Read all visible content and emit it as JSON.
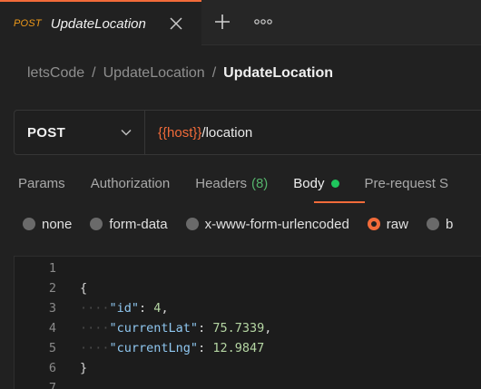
{
  "tab": {
    "method": "POST",
    "title": "UpdateLocation"
  },
  "breadcrumb": {
    "workspace": "letsCode",
    "collection": "UpdateLocation",
    "request": "UpdateLocation",
    "separator": "/"
  },
  "request": {
    "method": "POST",
    "url_variable": "{{host}}",
    "url_path": "/location"
  },
  "subtabs": {
    "params": "Params",
    "authorization": "Authorization",
    "headers": "Headers",
    "headers_count": "(8)",
    "body": "Body",
    "prerequest": "Pre-request S"
  },
  "body_types": {
    "none": "none",
    "form_data": "form-data",
    "urlencoded": "x-www-form-urlencoded",
    "raw": "raw",
    "binary": "b",
    "selected": "raw"
  },
  "editor": {
    "line_numbers": [
      "1",
      "2",
      "3",
      "4",
      "5",
      "6",
      "7"
    ],
    "open_brace": "{",
    "close_brace": "}",
    "fields": [
      {
        "key": "\"id\"",
        "value": "4",
        "suffix": ","
      },
      {
        "key": "\"currentLat\"",
        "value": "75.7339",
        "suffix": ","
      },
      {
        "key": "\"currentLng\"",
        "value": "12.9847",
        "suffix": ""
      }
    ],
    "indent_guide": "····"
  },
  "colors": {
    "accent": "#f26b3a",
    "post_method": "#f09a1a",
    "active_dot": "#1fc75d",
    "json_key": "#8fc7f0",
    "json_number": "#b5d6a3"
  },
  "icons": [
    "close-icon",
    "plus-icon",
    "more-icon",
    "chevron-down-icon"
  ]
}
